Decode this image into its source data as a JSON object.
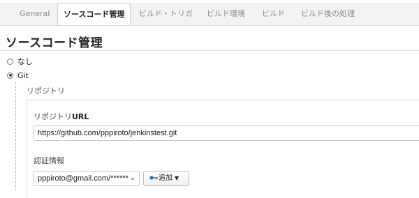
{
  "tabs": [
    {
      "label": "General"
    },
    {
      "label": "ソースコード管理",
      "active": true
    },
    {
      "label": "ビルド・トリガ"
    },
    {
      "label": "ビルド環境"
    },
    {
      "label": "ビルド"
    },
    {
      "label": "ビルド後の処理"
    }
  ],
  "section": {
    "title": "ソースコード管理"
  },
  "scm_options": [
    {
      "label": "なし",
      "selected": false
    },
    {
      "label": "Git",
      "selected": true
    }
  ],
  "repository": {
    "group_label": "リポジトリ",
    "url_label_prefix": "リポジトリ",
    "url_label_suffix": "URL",
    "url_value": "https://github.com/pppiroto/jenkinstest.git",
    "credentials_label": "認証情報",
    "credentials_value": "pppiroto@gmail.com/******",
    "add_button_label": "追加"
  },
  "colors": {
    "accent": "#2a6ebb",
    "border": "#c9c9c9"
  },
  "icons": {
    "key": "key-icon",
    "select_chevron": "chevron-down-icon",
    "button_caret": "caret-down-icon"
  }
}
